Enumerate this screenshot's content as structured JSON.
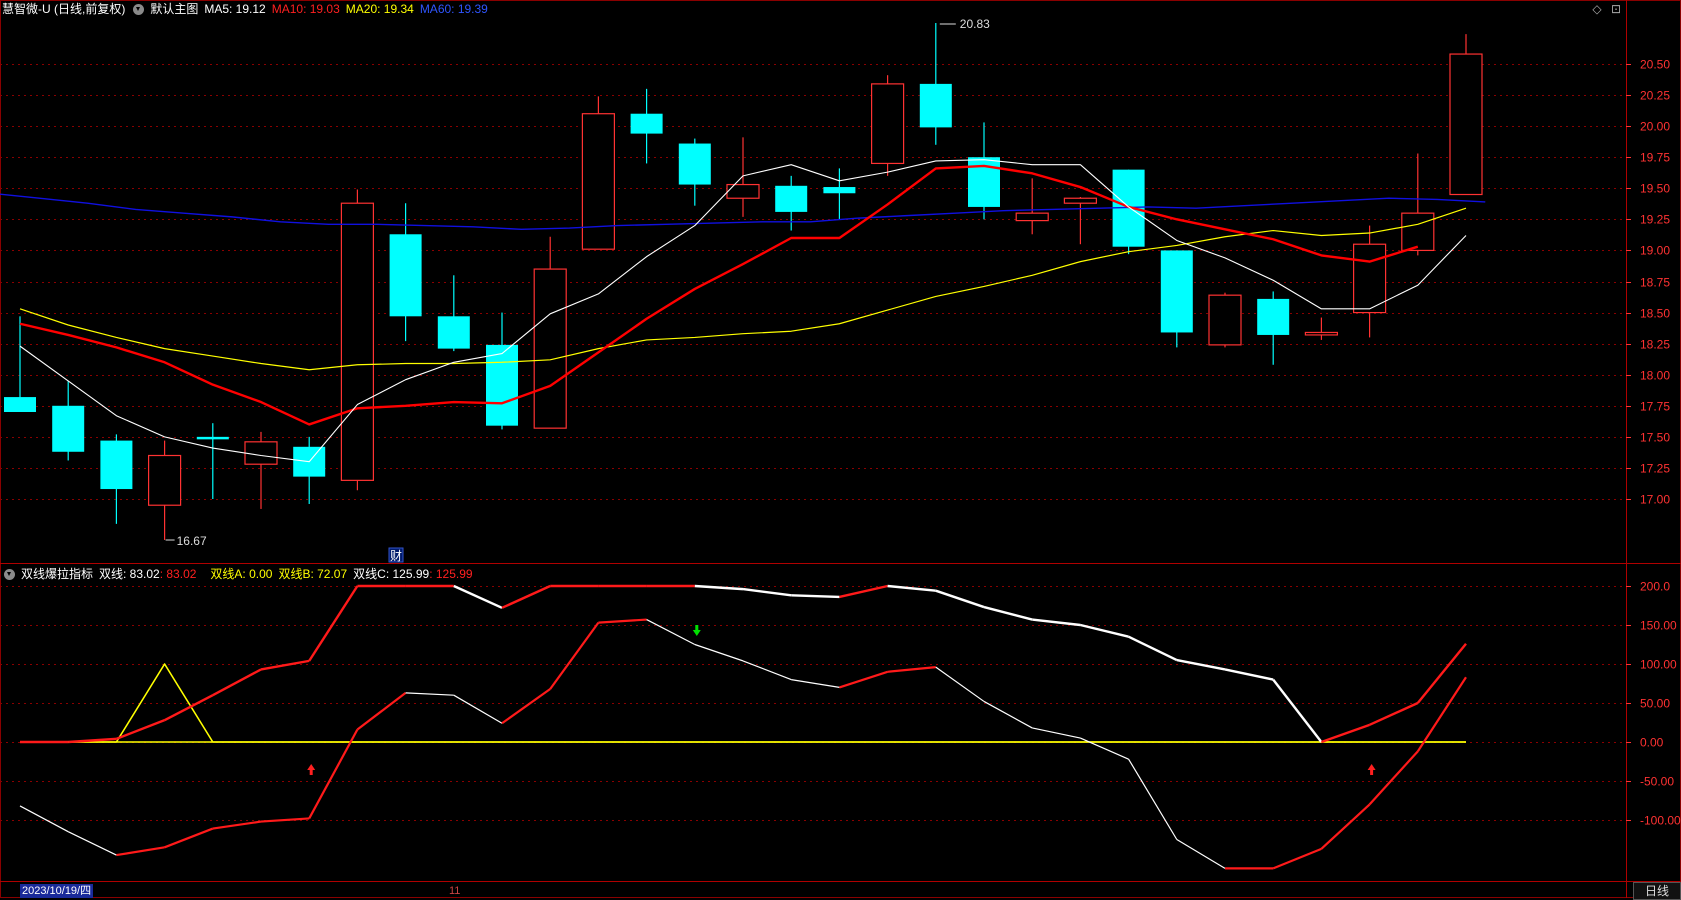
{
  "main_header": {
    "stock": "慧智微-U (日线,前复权)",
    "template": "默认主图",
    "ma5_label": "MA5: 19.12",
    "ma10_label": "MA10: 19.03",
    "ma20_label": "MA20: 19.34",
    "ma60_label": "MA60: 19.39"
  },
  "sub_header": {
    "name": "双线爆拉指标",
    "line_label": "双线: 83.02",
    "line_value": ": 83.02",
    "a_label": "双线A: 0.00",
    "b_label": "双线B: 72.07",
    "c_label": "双线C: 125.99",
    "c_value": ": 125.99"
  },
  "icons": {
    "diamond": "◇",
    "restore": "⊡"
  },
  "colors": {
    "up": "#ff3232",
    "down": "#00ffff",
    "ma5": "#ffffff",
    "ma10": "#ff0000",
    "ma20": "#ffff00",
    "ma60": "#0000ff",
    "axis": "#ff3232",
    "grid": "#8a0000"
  },
  "annotations": {
    "high": "20.83",
    "low": "16.67",
    "cai_marker": "财"
  },
  "bottom_bar": {
    "date": "2023/10/19/四",
    "month_tick": "11",
    "period": "日线"
  },
  "chart_data": [
    {
      "type": "candlestick",
      "title": "慧智微-U (日线,前复权)",
      "ylim": [
        16.6,
        20.9
      ],
      "yticks": [
        "20.50",
        "20.25",
        "20.00",
        "19.75",
        "19.50",
        "19.25",
        "19.00",
        "18.75",
        "18.50",
        "18.25",
        "18.00",
        "17.75",
        "17.50",
        "17.25",
        "17.00"
      ],
      "candles": [
        {
          "o": 17.82,
          "c": 17.7,
          "h": 18.47,
          "l": 17.7
        },
        {
          "o": 17.75,
          "c": 17.38,
          "h": 17.95,
          "l": 17.31
        },
        {
          "o": 17.47,
          "c": 17.08,
          "h": 17.52,
          "l": 16.8
        },
        {
          "o": 16.95,
          "c": 17.35,
          "h": 17.47,
          "l": 16.67
        },
        {
          "o": 17.5,
          "c": 17.48,
          "h": 17.61,
          "l": 17.0
        },
        {
          "o": 17.28,
          "c": 17.46,
          "h": 17.54,
          "l": 16.92
        },
        {
          "o": 17.42,
          "c": 17.18,
          "h": 17.5,
          "l": 16.96
        },
        {
          "o": 17.15,
          "c": 19.38,
          "h": 19.49,
          "l": 17.07
        },
        {
          "o": 19.13,
          "c": 18.47,
          "h": 19.38,
          "l": 18.27
        },
        {
          "o": 18.47,
          "c": 18.21,
          "h": 18.8,
          "l": 18.19
        },
        {
          "o": 18.24,
          "c": 17.59,
          "h": 18.5,
          "l": 17.56
        },
        {
          "o": 17.57,
          "c": 18.85,
          "h": 19.11,
          "l": 17.57
        },
        {
          "o": 19.01,
          "c": 20.1,
          "h": 20.24,
          "l": 19.01
        },
        {
          "o": 20.1,
          "c": 19.94,
          "h": 20.3,
          "l": 19.7
        },
        {
          "o": 19.86,
          "c": 19.53,
          "h": 19.9,
          "l": 19.36
        },
        {
          "o": 19.42,
          "c": 19.53,
          "h": 19.91,
          "l": 19.27
        },
        {
          "o": 19.52,
          "c": 19.31,
          "h": 19.6,
          "l": 19.16
        },
        {
          "o": 19.51,
          "c": 19.46,
          "h": 19.66,
          "l": 19.25
        },
        {
          "o": 19.7,
          "c": 20.34,
          "h": 20.41,
          "l": 19.6
        },
        {
          "o": 20.34,
          "c": 19.99,
          "h": 20.83,
          "l": 19.85
        },
        {
          "o": 19.75,
          "c": 19.35,
          "h": 20.03,
          "l": 19.25
        },
        {
          "o": 19.24,
          "c": 19.3,
          "h": 19.58,
          "l": 19.13
        },
        {
          "o": 19.38,
          "c": 19.42,
          "h": 19.43,
          "l": 19.05
        },
        {
          "o": 19.65,
          "c": 19.03,
          "h": 19.65,
          "l": 18.97
        },
        {
          "o": 19.0,
          "c": 18.34,
          "h": 19.0,
          "l": 18.22
        },
        {
          "o": 18.24,
          "c": 18.64,
          "h": 18.66,
          "l": 18.22
        },
        {
          "o": 18.61,
          "c": 18.32,
          "h": 18.67,
          "l": 18.08
        },
        {
          "o": 18.32,
          "c": 18.34,
          "h": 18.46,
          "l": 18.28
        },
        {
          "o": 18.5,
          "c": 19.05,
          "h": 19.2,
          "l": 18.3
        },
        {
          "o": 19.0,
          "c": 19.3,
          "h": 19.78,
          "l": 18.96
        },
        {
          "o": 19.45,
          "c": 20.58,
          "h": 20.74,
          "l": 19.45
        }
      ],
      "series": [
        {
          "name": "MA5",
          "values": [
            18.23,
            17.95,
            17.67,
            17.5,
            17.41,
            17.35,
            17.3,
            17.76,
            17.96,
            18.1,
            18.17,
            18.49,
            18.65,
            18.95,
            19.2,
            19.6,
            19.69,
            19.56,
            19.63,
            19.72,
            19.73,
            19.69,
            19.69,
            19.35,
            19.08,
            18.94,
            18.76,
            18.53,
            18.53,
            18.72,
            19.12
          ]
        },
        {
          "name": "MA10",
          "values": [
            18.41,
            18.32,
            18.22,
            18.1,
            17.92,
            17.78,
            17.6,
            17.73,
            17.75,
            17.78,
            17.77,
            17.91,
            18.18,
            18.45,
            18.69,
            18.89,
            19.1,
            19.1,
            19.37,
            19.66,
            19.68,
            19.62,
            19.51,
            19.35,
            19.25,
            19.17,
            19.09,
            18.96,
            18.91,
            19.03
          ]
        },
        {
          "name": "MA20",
          "values": [
            18.53,
            18.4,
            18.3,
            18.21,
            18.15,
            18.09,
            18.04,
            18.08,
            18.09,
            18.09,
            18.1,
            18.12,
            18.21,
            18.28,
            18.3,
            18.33,
            18.35,
            18.41,
            18.52,
            18.63,
            18.71,
            18.8,
            18.91,
            18.99,
            19.04,
            19.11,
            19.16,
            19.12,
            19.14,
            19.21,
            19.34
          ]
        },
        {
          "name": "MA60",
          "values": [
            19.46,
            19.42,
            19.38,
            19.33,
            19.3,
            19.27,
            19.23,
            19.21,
            19.21,
            19.2,
            19.19,
            19.17,
            19.18,
            19.2,
            19.21,
            19.22,
            19.23,
            19.23,
            19.26,
            19.28,
            19.3,
            19.32,
            19.33,
            19.34,
            19.35,
            19.34,
            19.36,
            19.38,
            19.4,
            19.42,
            19.41,
            19.39
          ]
        }
      ]
    },
    {
      "type": "line",
      "title": "双线爆拉指标",
      "ylim": [
        -185,
        215
      ],
      "yticks": [
        "200.0",
        "150.00",
        "100.00",
        "50.00",
        "0.00",
        "-50.00",
        "-100.00"
      ],
      "series": [
        {
          "name": "双线",
          "values": [
            -82,
            -115,
            -145,
            -135,
            -111,
            -102,
            -98,
            16,
            63,
            60,
            24,
            68,
            153,
            157,
            125,
            104,
            80,
            70,
            90,
            96,
            52,
            18,
            5,
            -22,
            -125,
            -162,
            -162,
            -137,
            -80,
            -12,
            83.02
          ]
        },
        {
          "name": "双线A",
          "values": [
            0,
            0,
            0,
            0,
            0,
            0,
            0,
            0,
            0,
            0,
            0,
            0,
            0,
            0,
            0,
            0,
            0,
            0,
            0,
            0,
            0,
            0,
            0,
            0,
            0,
            0,
            0,
            0,
            0,
            0,
            0
          ]
        },
        {
          "name": "双线B",
          "values": [
            0,
            0,
            0,
            100,
            0,
            0,
            0,
            0,
            0,
            0,
            0,
            0,
            0,
            0,
            0,
            0,
            0,
            0,
            0,
            0,
            0,
            0,
            0,
            0,
            0,
            0,
            0,
            0,
            0,
            0,
            0
          ]
        },
        {
          "name": "双线C",
          "values": [
            0,
            0,
            4,
            28,
            60,
            93,
            104,
            200,
            200,
            200,
            172,
            200,
            200,
            200,
            200,
            196,
            188,
            186,
            200,
            194,
            173,
            157,
            150,
            135,
            105,
            93,
            80,
            0,
            22,
            50,
            125.99
          ]
        }
      ],
      "arrows_up": [
        6,
        28
      ],
      "arrows_down": [
        14
      ]
    }
  ]
}
